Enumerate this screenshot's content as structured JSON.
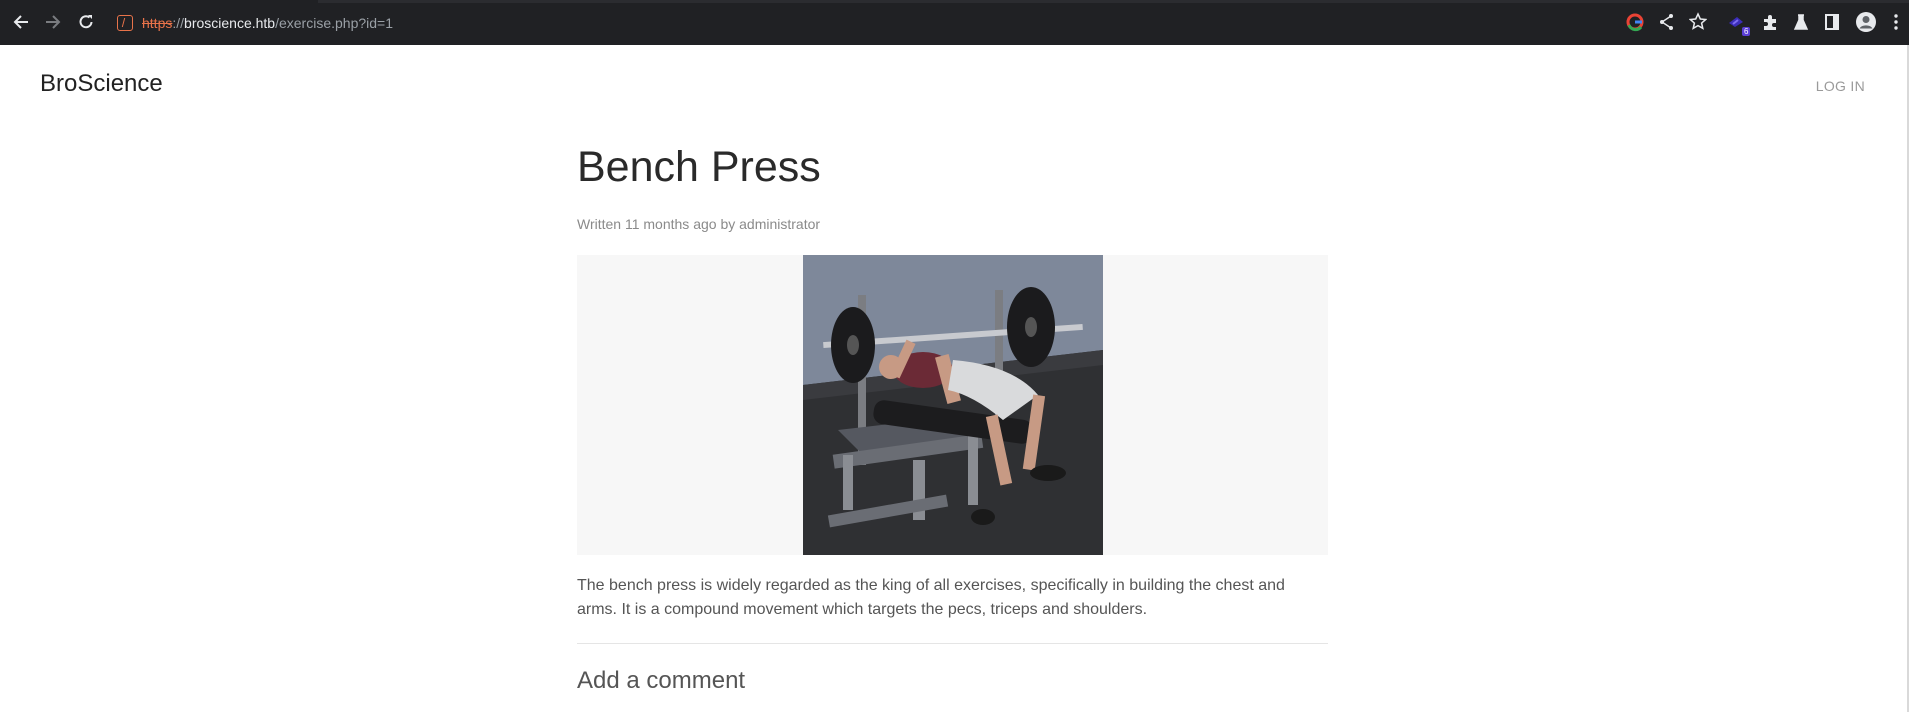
{
  "browser": {
    "url_scheme": "https",
    "url_sep": "://",
    "url_host": "broscience.htb",
    "url_path": "/exercise.php?id=1",
    "extension_badge": "6",
    "icons": [
      "back-icon",
      "forward-icon",
      "reload-icon",
      "site-warning-icon",
      "google-icon",
      "share-icon",
      "star-icon",
      "extension-icon",
      "puzzle-icon",
      "labs-icon",
      "side-panel-icon",
      "profile-icon",
      "menu-icon"
    ]
  },
  "header": {
    "brand": "BroScience",
    "login": "LOG IN"
  },
  "article": {
    "title": "Bench Press",
    "meta": "Written 11 months ago by administrator",
    "body": "The bench press is widely regarded as the king of all exercises, specifically in building the chest and arms. It is a compound movement which targets the pecs, triceps and shoulders.",
    "comment_heading": "Add a comment"
  },
  "colors": {
    "chrome_bg": "#202124",
    "url_warning": "#e8734a",
    "image_bg": "#f7f7f7"
  }
}
